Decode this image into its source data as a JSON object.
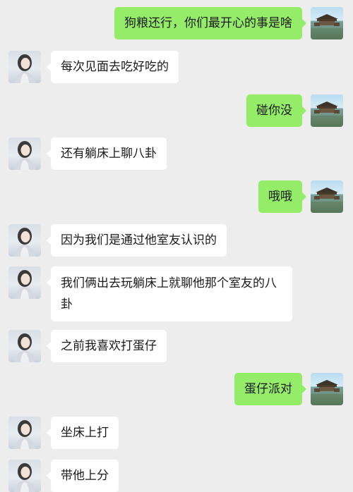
{
  "messages": [
    {
      "side": "right",
      "text": "狗粮还行，你们最开心的事是啥"
    },
    {
      "side": "left",
      "text": "每次见面去吃好吃的"
    },
    {
      "side": "right",
      "text": "碰你没"
    },
    {
      "side": "left",
      "text": "还有躺床上聊八卦"
    },
    {
      "side": "right",
      "text": "哦哦"
    },
    {
      "side": "left",
      "text": "因为我们是通过他室友认识的"
    },
    {
      "side": "left",
      "text": "我们俩出去玩躺床上就聊他那个室友的八卦"
    },
    {
      "side": "left",
      "text": "之前我喜欢打蛋仔"
    },
    {
      "side": "right",
      "text": "蛋仔派对"
    },
    {
      "side": "left",
      "text": "坐床上打"
    },
    {
      "side": "left",
      "text": "带他上分"
    }
  ],
  "colors": {
    "background": "#ededed",
    "sent_bubble": "#95ec69",
    "received_bubble": "#ffffff",
    "text": "#1a1a1a"
  },
  "icons": {
    "sender_avatar": "temple-landscape-avatar",
    "receiver_avatar": "girl-portrait-avatar"
  }
}
